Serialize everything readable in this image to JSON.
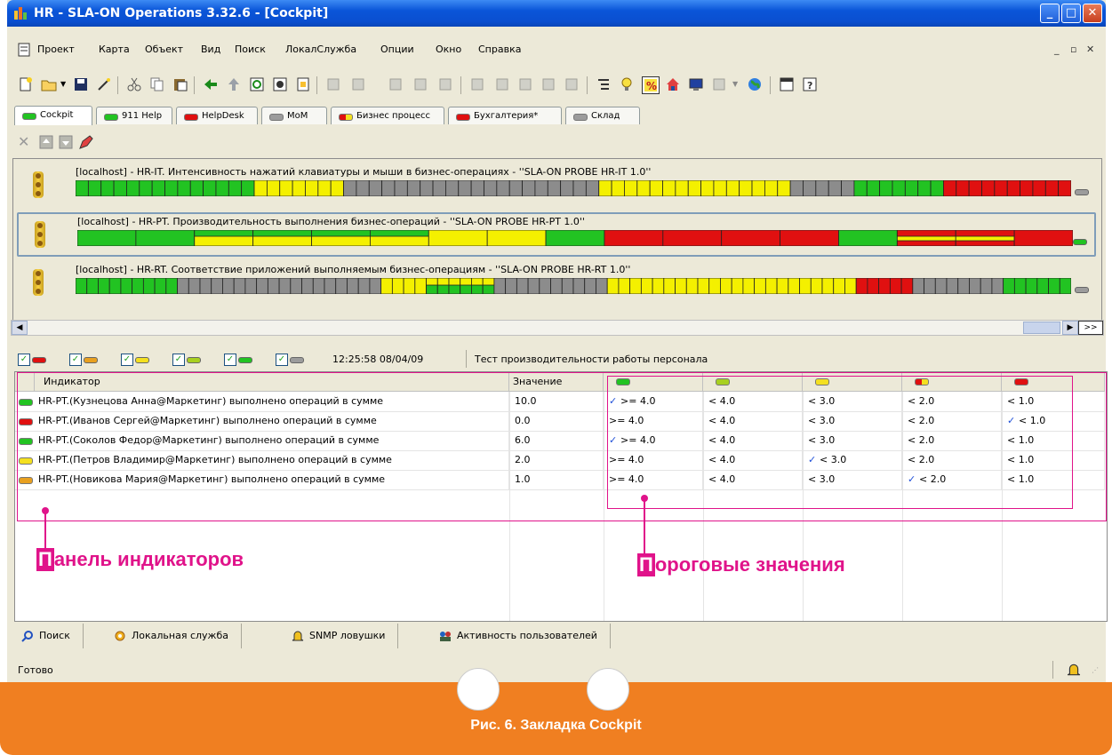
{
  "window": {
    "title": "HR - SLA-ON Operations 3.32.6 - [Cockpit]"
  },
  "menu": [
    "Проект",
    "Карта",
    "Объект",
    "Вид",
    "Поиск",
    "ЛокалСлужба",
    "Опции",
    "Окно",
    "Справка"
  ],
  "tabs": [
    {
      "label": "Cockpit",
      "color": "#22c322"
    },
    {
      "label": "911 Help",
      "color": "#22c322"
    },
    {
      "label": "HelpDesk",
      "color": "#e01010"
    },
    {
      "label": "MoM",
      "color": "#9c9c9c"
    },
    {
      "label": "Бизнес процесс",
      "color": "#e8a020"
    },
    {
      "label": "Бухгалтерия*",
      "color": "#e01010"
    },
    {
      "label": "Склад",
      "color": "#9c9c9c"
    }
  ],
  "probes": [
    {
      "title": "[localhost] - HR-IT. Интенсивность нажатий  клавиатуры и мыши в бизнес-операциях - ''SLA-ON PROBE HR-IT 1.0''",
      "segments": [
        "g",
        "g",
        "g",
        "g",
        "g",
        "g",
        "g",
        "g",
        "g",
        "g",
        "g",
        "g",
        "g",
        "g",
        "y",
        "y",
        "y",
        "y",
        "y",
        "y",
        "y",
        "gr",
        "gr",
        "gr",
        "gr",
        "gr",
        "gr",
        "gr",
        "gr",
        "gr",
        "gr",
        "gr",
        "gr",
        "gr",
        "gr",
        "gr",
        "gr",
        "gr",
        "gr",
        "gr",
        "gr",
        "y",
        "y",
        "y",
        "y",
        "y",
        "y",
        "y",
        "y",
        "y",
        "y",
        "y",
        "y",
        "y",
        "y",
        "y",
        "gr",
        "gr",
        "gr",
        "gr",
        "gr",
        "g",
        "g",
        "g",
        "g",
        "g",
        "g",
        "g",
        "r",
        "r",
        "r",
        "r",
        "r",
        "r",
        "r",
        "r",
        "r",
        "r"
      ],
      "end": "#9c9c9c"
    },
    {
      "title": "[localhost] - HR-PT. Производительность выполнения бизнес-операций - ''SLA-ON PROBE HR-PT 1.0''",
      "segments": [
        "g",
        "g",
        "yb",
        "yb",
        "yb",
        "yb",
        "y",
        "y",
        "g",
        "r",
        "r",
        "r",
        "r",
        "g",
        "yr",
        "yr",
        "r"
      ],
      "end": "#22c322"
    },
    {
      "title": "[localhost] - HR-RT. Соответствие приложений выполняемым бизнес-операциям - ''SLA-ON PROBE HR-RT 1.0''",
      "segments": [
        "g",
        "g",
        "g",
        "g",
        "g",
        "g",
        "g",
        "g",
        "g",
        "gr",
        "gr",
        "gr",
        "gr",
        "gr",
        "gr",
        "gr",
        "gr",
        "gr",
        "gr",
        "gr",
        "gr",
        "gr",
        "gr",
        "gr",
        "gr",
        "gr",
        "gr",
        "y",
        "y",
        "y",
        "y",
        "yg",
        "yg",
        "yg",
        "yg",
        "yg",
        "yg",
        "gr",
        "gr",
        "gr",
        "gr",
        "gr",
        "gr",
        "gr",
        "gr",
        "gr",
        "gr",
        "y",
        "y",
        "y",
        "y",
        "y",
        "y",
        "y",
        "y",
        "y",
        "y",
        "y",
        "y",
        "y",
        "y",
        "y",
        "y",
        "y",
        "y",
        "y",
        "y",
        "y",
        "y",
        "r",
        "r",
        "r",
        "r",
        "r",
        "gr",
        "gr",
        "gr",
        "gr",
        "gr",
        "gr",
        "gr",
        "gr",
        "g",
        "g",
        "g",
        "g",
        "g",
        "g"
      ],
      "end": "#9c9c9c"
    }
  ],
  "filter": {
    "pills": [
      "#e01010",
      "#e8a020",
      "#f4e020",
      "#a8d020",
      "#22c322",
      "#9c9c9c"
    ],
    "timestamp": "12:25:58 08/04/09",
    "description": "Тест производительности работы персонала"
  },
  "grid": {
    "headers": [
      "Индикатор",
      "Значение"
    ],
    "threshold_colors": [
      "#22c322",
      "#a8d020",
      "#f4e020",
      "#e8a020",
      "#e01010"
    ],
    "rows": [
      {
        "color": "#22c322",
        "name": "HR-PT.(Кузнецова Анна@Маркетинг) выполнено операций в сумме",
        "value": "10.0",
        "t": [
          "✓ >= 4.0",
          "< 4.0",
          "< 3.0",
          "< 2.0",
          "< 1.0"
        ],
        "check": 0
      },
      {
        "color": "#e01010",
        "name": "HR-PT.(Иванов Сергей@Маркетинг) выполнено операций в сумме",
        "value": "0.0",
        "t": [
          ">= 4.0",
          "< 4.0",
          "< 3.0",
          "< 2.0",
          "✓ < 1.0"
        ],
        "check": 4
      },
      {
        "color": "#22c322",
        "name": "HR-PT.(Соколов Федор@Маркетинг) выполнено операций в сумме",
        "value": "6.0",
        "t": [
          "✓ >= 4.0",
          "< 4.0",
          "< 3.0",
          "< 2.0",
          "< 1.0"
        ],
        "check": 0
      },
      {
        "color": "#f4e020",
        "name": "HR-PT.(Петров Владимир@Маркетинг) выполнено операций в сумме",
        "value": "2.0",
        "t": [
          ">= 4.0",
          "< 4.0",
          "✓ < 3.0",
          "< 2.0",
          "< 1.0"
        ],
        "check": 2
      },
      {
        "color": "#e8a020",
        "name": "HR-PT.(Новикова Мария@Маркетинг) выполнено операций в сумме",
        "value": "1.0",
        "t": [
          ">= 4.0",
          "< 4.0",
          "< 3.0",
          "✓ < 2.0",
          "< 1.0"
        ],
        "check": 3
      }
    ]
  },
  "callouts": {
    "left": "Панель индикаторов",
    "right": "Пороговые значения"
  },
  "bottom_tabs": [
    "Поиск",
    "Локальная служба",
    "SNMP ловушки",
    "Активность пользователей"
  ],
  "status": "Готово",
  "caption": "Рис. 6. Закладка Cockpit"
}
